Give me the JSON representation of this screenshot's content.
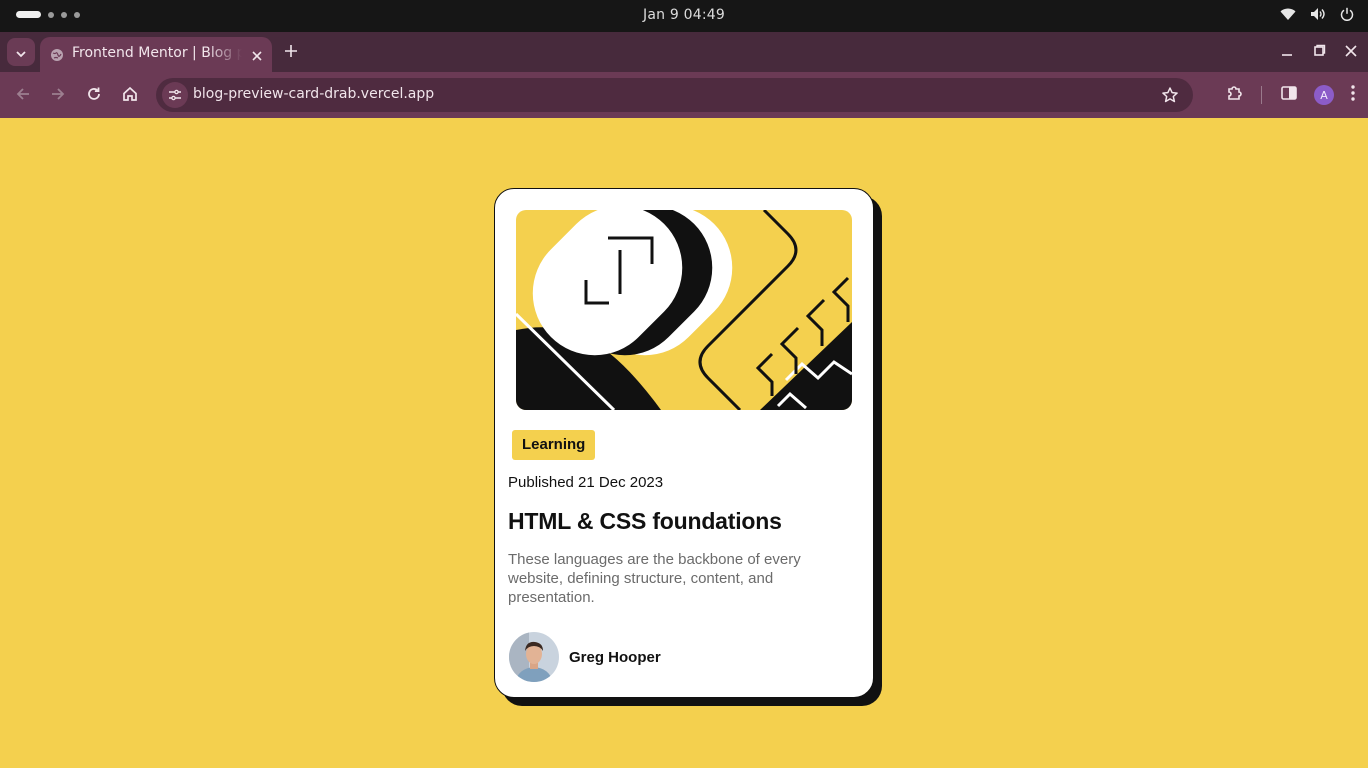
{
  "os": {
    "clock": "Jan 9  04:49",
    "icons": [
      "wifi-icon",
      "volume-icon",
      "power-icon"
    ]
  },
  "browser": {
    "tab": {
      "title": "Frontend Mentor | Blog preview card"
    },
    "address": {
      "url": "blog-preview-card-drab.vercel.app"
    },
    "profile_initial": "A"
  },
  "card": {
    "tag": "Learning",
    "published": "Published 21 Dec 2023",
    "title": "HTML & CSS foundations",
    "description": "These languages are the backbone of every website, defining structure, content, and presentation.",
    "author": {
      "name": "Greg Hooper"
    }
  },
  "colors": {
    "background": "#f4d04e",
    "card": "#ffffff",
    "ink": "#111111",
    "muted_text": "#6b6b6b",
    "tab_strip": "#472a3c",
    "toolbar": "#6b3a55"
  }
}
